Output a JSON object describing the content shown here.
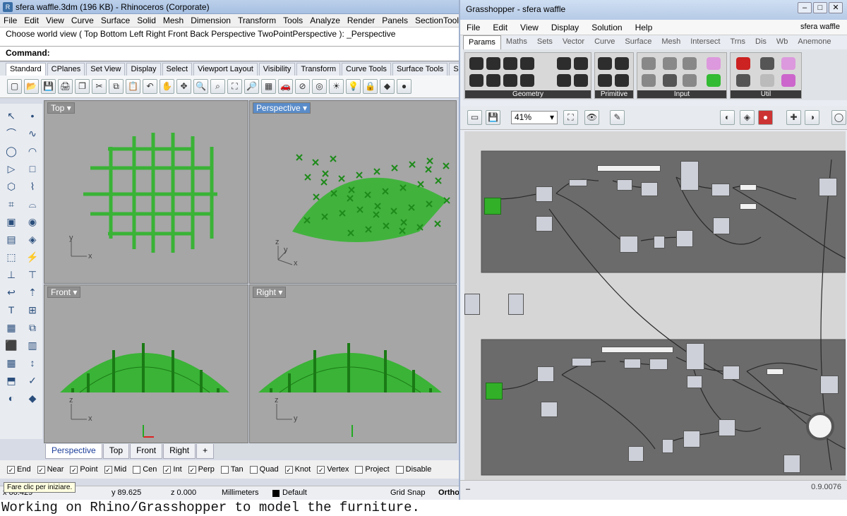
{
  "rhino": {
    "title": "sfera waffle.3dm (196 KB) - Rhinoceros (Corporate)",
    "menu": [
      "File",
      "Edit",
      "View",
      "Curve",
      "Surface",
      "Solid",
      "Mesh",
      "Dimension",
      "Transform",
      "Tools",
      "Analyze",
      "Render",
      "Panels",
      "SectionTools"
    ],
    "command_history": "Choose world view ( Top  Bottom  Left  Right  Front  Back  Perspective  TwoPointPerspective ): _Perspective",
    "command_label": "Command:",
    "toolbar_tabs": [
      "Standard",
      "CPlanes",
      "Set View",
      "Display",
      "Select",
      "Viewport Layout",
      "Visibility",
      "Transform",
      "Curve Tools",
      "Surface Tools",
      "Soli"
    ],
    "toolbar_icons": [
      "▢",
      "📂",
      "💾",
      "🖨",
      "❐",
      "✂",
      "⧉",
      "📋",
      "↶",
      "✋",
      "✥",
      "🔍",
      "⌕",
      "⛶",
      "🔎",
      "▦",
      "🚗",
      "⊘",
      "◎",
      "☀",
      "💡",
      "🔒",
      "◆",
      "●"
    ],
    "left_tools": [
      "↖",
      "•",
      "⌒",
      "∿",
      "◯",
      "◠",
      "▷",
      "□",
      "⬡",
      "⌇",
      "⌗",
      "⌓",
      "▣",
      "◉",
      "▤",
      "◈",
      "⬚",
      "⚡",
      "⊥",
      "⊤",
      "↩",
      "⇡",
      "T",
      "⊞",
      "▦",
      "⧉",
      "⬛",
      "▥",
      "▦",
      "↕",
      "⬒",
      "✓",
      "◐",
      "◆"
    ],
    "viewports": {
      "top": {
        "label": "Top",
        "x": "x",
        "y": "y"
      },
      "perspective": {
        "label": "Perspective",
        "x": "x",
        "y": "y",
        "z": "z"
      },
      "front": {
        "label": "Front",
        "x": "x",
        "z": "z"
      },
      "right": {
        "label": "Right",
        "y": "y",
        "z": "z"
      }
    },
    "viewport_tabs": [
      "Perspective",
      "Top",
      "Front",
      "Right",
      "+"
    ],
    "osnaps": [
      {
        "label": "End",
        "checked": true
      },
      {
        "label": "Near",
        "checked": true
      },
      {
        "label": "Point",
        "checked": true
      },
      {
        "label": "Mid",
        "checked": true
      },
      {
        "label": "Cen",
        "checked": false
      },
      {
        "label": "Int",
        "checked": true
      },
      {
        "label": "Perp",
        "checked": true
      },
      {
        "label": "Tan",
        "checked": false
      },
      {
        "label": "Quad",
        "checked": false
      },
      {
        "label": "Knot",
        "checked": true
      },
      {
        "label": "Vertex",
        "checked": true
      },
      {
        "label": "Project",
        "checked": false
      },
      {
        "label": "Disable",
        "checked": false
      }
    ],
    "status": {
      "x": "x 66.429",
      "y": "y 89.625",
      "z": "z 0.000",
      "units": "Millimeters",
      "layer": "Default",
      "grid_snap": "Grid Snap",
      "ortho": "Ortho"
    },
    "tooltip": "Fare clic per iniziare."
  },
  "grasshopper": {
    "title": "Grasshopper - sfera waffle",
    "menu": [
      "File",
      "Edit",
      "View",
      "Display",
      "Solution",
      "Help"
    ],
    "doc_name": "sfera waffle",
    "tabs": [
      "Params",
      "Maths",
      "Sets",
      "Vector",
      "Curve",
      "Surface",
      "Mesh",
      "Intersect",
      "Trns",
      "Dis",
      "Wb",
      "Anemone"
    ],
    "ribbon_groups": [
      "Geometry",
      "Primitive",
      "Input",
      "Util"
    ],
    "zoom": "41%",
    "version": "0.9.0076"
  },
  "caption": "Working on Rhino/Grasshopper to model the furniture.",
  "colors": {
    "accent_green": "#2fb52a",
    "viewport_bg": "#a6a6a6",
    "canvas_bg": "#d6d6d6",
    "group_bg": "#6b6b6b"
  }
}
